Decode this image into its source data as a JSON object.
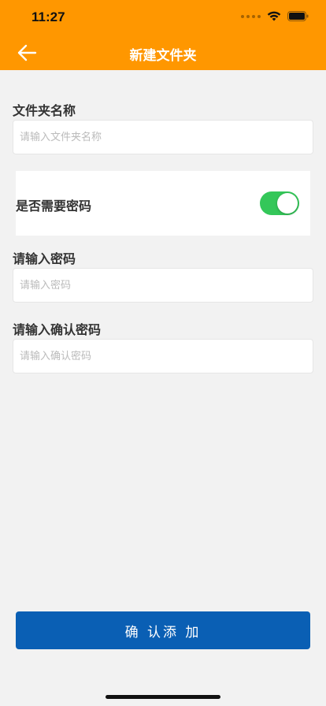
{
  "status_bar": {
    "time": "11:27"
  },
  "header": {
    "title": "新建文件夹",
    "background": "#ff9700"
  },
  "form": {
    "folder_name": {
      "label": "文件夹名称",
      "placeholder": "请输入文件夹名称",
      "value": ""
    },
    "need_password": {
      "label": "是否需要密码",
      "enabled": true,
      "toggle_color": "#34c759"
    },
    "password": {
      "label": "请输入密码",
      "placeholder": "请输入密码",
      "value": ""
    },
    "confirm_password": {
      "label": "请输入确认密码",
      "placeholder": "请输入确认密码",
      "value": ""
    }
  },
  "actions": {
    "confirm_label": "确 认添 加",
    "confirm_color": "#0a5fb4"
  },
  "icons": {
    "back": "arrow-left-icon",
    "wifi": "wifi-icon",
    "battery": "battery-icon",
    "signal": "signal-icon"
  }
}
